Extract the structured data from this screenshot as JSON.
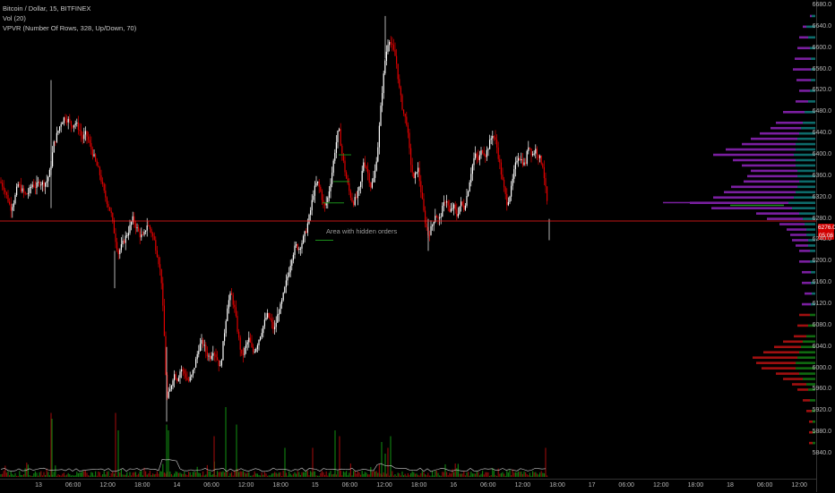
{
  "legend": {
    "symbol": "Bitcoin / Dollar, 15, BITFINEX",
    "volume": "Vol (20)",
    "vpvr": "VPVR (Number Of Rows, 328, Up/Down, 70)"
  },
  "annotation": "Area with hidden orders",
  "colors": {
    "up": "#ffffff",
    "down": "#e00000",
    "vol_up": "#0f7a0f",
    "vol_down": "#8a0b0b",
    "profile_up": "#0e6b6b",
    "profile_down": "#7a1fa0",
    "profile_up_low": "#106a10",
    "profile_down_low": "#a01010",
    "price_line": "#ff1a1a",
    "zone": "#1b8f1b"
  },
  "price_badge": {
    "price": "6276.0",
    "countdown": "05:06"
  },
  "chart_data": {
    "type": "candlestick",
    "ylim": [
      5820,
      6680
    ],
    "y_ticks": [
      "6680.0",
      "6640.0",
      "6600.0",
      "6560.0",
      "6520.0",
      "6480.0",
      "6440.0",
      "6400.0",
      "6360.0",
      "6320.0",
      "6280.0",
      "6240.0",
      "6200.0",
      "6160.0",
      "6120.0",
      "6080.0",
      "6040.0",
      "6000.0",
      "5960.0",
      "5920.0",
      "5880.0",
      "5840.0"
    ],
    "x_ticks": [
      "13",
      "06:00",
      "12:00",
      "18:00",
      "14",
      "06:00",
      "12:00",
      "18:00",
      "15",
      "06:00",
      "12:00",
      "18:00",
      "16",
      "06:00",
      "12:00",
      "18:00",
      "17",
      "06:00",
      "12:00",
      "18:00",
      "18",
      "06:00",
      "12:00"
    ],
    "last_price": 6276.0,
    "close_path": [
      [
        0,
        6350
      ],
      [
        4,
        6340
      ],
      [
        8,
        6320
      ],
      [
        12,
        6300
      ],
      [
        16,
        6315
      ],
      [
        20,
        6345
      ],
      [
        24,
        6335
      ],
      [
        28,
        6325
      ],
      [
        32,
        6330
      ],
      [
        36,
        6345
      ],
      [
        40,
        6340
      ],
      [
        44,
        6350
      ],
      [
        48,
        6345
      ],
      [
        52,
        6350
      ],
      [
        56,
        6370
      ],
      [
        60,
        6420
      ],
      [
        64,
        6440
      ],
      [
        68,
        6460
      ],
      [
        72,
        6470
      ],
      [
        76,
        6465
      ],
      [
        80,
        6455
      ],
      [
        84,
        6460
      ],
      [
        88,
        6450
      ],
      [
        92,
        6430
      ],
      [
        96,
        6440
      ],
      [
        100,
        6420
      ],
      [
        104,
        6400
      ],
      [
        108,
        6380
      ],
      [
        112,
        6360
      ],
      [
        116,
        6330
      ],
      [
        120,
        6310
      ],
      [
        124,
        6290
      ],
      [
        128,
        6250
      ],
      [
        132,
        6215
      ],
      [
        136,
        6230
      ],
      [
        140,
        6245
      ],
      [
        144,
        6260
      ],
      [
        148,
        6280
      ],
      [
        152,
        6265
      ],
      [
        156,
        6250
      ],
      [
        160,
        6245
      ],
      [
        164,
        6270
      ],
      [
        168,
        6260
      ],
      [
        172,
        6240
      ],
      [
        176,
        6210
      ],
      [
        180,
        6170
      ],
      [
        184,
        6040
      ],
      [
        186,
        5940
      ],
      [
        190,
        5960
      ],
      [
        194,
        5990
      ],
      [
        198,
        5980
      ],
      [
        202,
        6000
      ],
      [
        206,
        5990
      ],
      [
        210,
        5975
      ],
      [
        214,
        5985
      ],
      [
        218,
        6010
      ],
      [
        222,
        6040
      ],
      [
        226,
        6050
      ],
      [
        230,
        6030
      ],
      [
        234,
        6020
      ],
      [
        238,
        6035
      ],
      [
        242,
        6020
      ],
      [
        246,
        6000
      ],
      [
        250,
        6060
      ],
      [
        254,
        6120
      ],
      [
        258,
        6140
      ],
      [
        262,
        6110
      ],
      [
        266,
        6060
      ],
      [
        270,
        6020
      ],
      [
        274,
        6040
      ],
      [
        278,
        6055
      ],
      [
        282,
        6030
      ],
      [
        286,
        6040
      ],
      [
        290,
        6060
      ],
      [
        294,
        6080
      ],
      [
        298,
        6100
      ],
      [
        302,
        6090
      ],
      [
        306,
        6070
      ],
      [
        310,
        6100
      ],
      [
        314,
        6120
      ],
      [
        318,
        6150
      ],
      [
        322,
        6180
      ],
      [
        326,
        6210
      ],
      [
        330,
        6230
      ],
      [
        334,
        6225
      ],
      [
        338,
        6240
      ],
      [
        342,
        6260
      ],
      [
        346,
        6290
      ],
      [
        350,
        6330
      ],
      [
        354,
        6350
      ],
      [
        358,
        6330
      ],
      [
        362,
        6300
      ],
      [
        366,
        6320
      ],
      [
        370,
        6360
      ],
      [
        374,
        6410
      ],
      [
        378,
        6450
      ],
      [
        382,
        6400
      ],
      [
        386,
        6360
      ],
      [
        390,
        6330
      ],
      [
        394,
        6310
      ],
      [
        398,
        6320
      ],
      [
        402,
        6340
      ],
      [
        406,
        6390
      ],
      [
        410,
        6370
      ],
      [
        414,
        6340
      ],
      [
        418,
        6360
      ],
      [
        422,
        6420
      ],
      [
        426,
        6510
      ],
      [
        430,
        6580
      ],
      [
        434,
        6620
      ],
      [
        438,
        6600
      ],
      [
        442,
        6580
      ],
      [
        446,
        6520
      ],
      [
        450,
        6480
      ],
      [
        454,
        6460
      ],
      [
        458,
        6390
      ],
      [
        462,
        6350
      ],
      [
        466,
        6380
      ],
      [
        470,
        6330
      ],
      [
        474,
        6280
      ],
      [
        478,
        6250
      ],
      [
        482,
        6265
      ],
      [
        486,
        6290
      ],
      [
        490,
        6275
      ],
      [
        494,
        6300
      ],
      [
        498,
        6320
      ],
      [
        502,
        6290
      ],
      [
        506,
        6305
      ],
      [
        510,
        6285
      ],
      [
        514,
        6310
      ],
      [
        518,
        6300
      ],
      [
        522,
        6330
      ],
      [
        526,
        6370
      ],
      [
        530,
        6400
      ],
      [
        534,
        6390
      ],
      [
        538,
        6410
      ],
      [
        542,
        6400
      ],
      [
        546,
        6420
      ],
      [
        550,
        6440
      ],
      [
        554,
        6420
      ],
      [
        558,
        6380
      ],
      [
        562,
        6340
      ],
      [
        566,
        6310
      ],
      [
        570,
        6330
      ],
      [
        574,
        6370
      ],
      [
        578,
        6400
      ],
      [
        582,
        6390
      ],
      [
        586,
        6380
      ],
      [
        590,
        6420
      ],
      [
        594,
        6400
      ],
      [
        598,
        6410
      ],
      [
        602,
        6395
      ],
      [
        606,
        6380
      ],
      [
        610,
        6320
      ],
      [
        613,
        6276
      ]
    ],
    "volume_series": {
      "name": "Vol (20)",
      "spikes": [
        [
          57,
          11
        ],
        [
          58,
          10
        ],
        [
          129,
          11
        ],
        [
          132,
          8
        ],
        [
          186,
          9
        ],
        [
          188,
          8
        ],
        [
          239,
          7
        ],
        [
          252,
          12
        ],
        [
          264,
          9
        ],
        [
          318,
          5
        ],
        [
          349,
          5
        ],
        [
          374,
          8
        ],
        [
          379,
          7
        ],
        [
          426,
          6
        ],
        [
          430,
          4
        ],
        [
          433,
          5
        ],
        [
          436,
          7
        ],
        [
          609,
          5
        ]
      ]
    },
    "vpvr": {
      "name": "VPVR (Number Of Rows, 328, Up/Down, 70)",
      "levels": [
        [
          6660,
          4,
          2
        ],
        [
          6640,
          10,
          4
        ],
        [
          6620,
          8,
          10
        ],
        [
          6600,
          6,
          14
        ],
        [
          6580,
          5,
          18
        ],
        [
          6560,
          5,
          20
        ],
        [
          6540,
          5,
          16
        ],
        [
          6520,
          6,
          12
        ],
        [
          6500,
          8,
          14
        ],
        [
          6480,
          12,
          24
        ],
        [
          6460,
          14,
          30
        ],
        [
          6450,
          16,
          34
        ],
        [
          6440,
          18,
          44
        ],
        [
          6430,
          20,
          52
        ],
        [
          6420,
          22,
          60
        ],
        [
          6410,
          22,
          78
        ],
        [
          6400,
          24,
          90
        ],
        [
          6390,
          22,
          70
        ],
        [
          6380,
          22,
          60
        ],
        [
          6370,
          20,
          52
        ],
        [
          6360,
          20,
          56
        ],
        [
          6350,
          18,
          62
        ],
        [
          6340,
          20,
          74
        ],
        [
          6330,
          22,
          80
        ],
        [
          6320,
          24,
          90
        ],
        [
          6310,
          30,
          110
        ],
        [
          6300,
          26,
          90
        ],
        [
          6290,
          18,
          48
        ],
        [
          6280,
          14,
          40
        ],
        [
          6270,
          12,
          28
        ],
        [
          6260,
          10,
          22
        ],
        [
          6250,
          10,
          18
        ],
        [
          6240,
          8,
          18
        ],
        [
          6230,
          8,
          14
        ],
        [
          6220,
          6,
          12
        ],
        [
          6200,
          6,
          12
        ],
        [
          6180,
          5,
          10
        ],
        [
          6160,
          5,
          10
        ],
        [
          6140,
          4,
          8
        ],
        [
          6120,
          5,
          10
        ],
        [
          6100,
          6,
          12
        ],
        [
          6080,
          8,
          12
        ],
        [
          6060,
          10,
          14
        ],
        [
          6050,
          14,
          22
        ],
        [
          6040,
          16,
          30
        ],
        [
          6030,
          18,
          40
        ],
        [
          6020,
          20,
          50
        ],
        [
          6010,
          22,
          44
        ],
        [
          6000,
          22,
          38
        ],
        [
          5990,
          18,
          26
        ],
        [
          5980,
          14,
          22
        ],
        [
          5970,
          10,
          16
        ],
        [
          5960,
          8,
          12
        ],
        [
          5940,
          6,
          8
        ],
        [
          5920,
          4,
          6
        ],
        [
          5900,
          3,
          4
        ],
        [
          5880,
          3,
          4
        ],
        [
          5860,
          3,
          4
        ]
      ]
    }
  }
}
